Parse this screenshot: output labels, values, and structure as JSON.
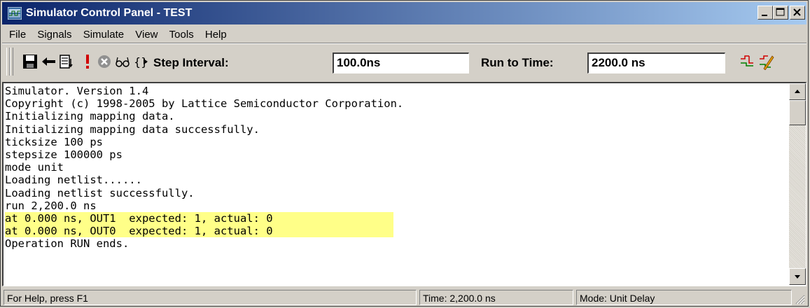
{
  "window": {
    "title": "Simulator Control Panel - TEST",
    "controls": [
      "minimize-icon",
      "maximize-icon",
      "close-icon"
    ]
  },
  "menu": [
    "File",
    "Signals",
    "Simulate",
    "View",
    "Tools",
    "Help"
  ],
  "toolbar": {
    "icons": [
      "save-icon",
      "back-arrow-icon",
      "list-step-icon",
      "run-exclamation-icon",
      "stop-icon",
      "glasses-icon",
      "step-into-icon"
    ],
    "step_interval_label": "Step Interval:",
    "step_interval_value": "100.0ns",
    "run_to_time_label": "Run to Time:",
    "run_to_time_value": "2200.0 ns",
    "right_icons": [
      "waveform-icon",
      "waveform-edit-icon"
    ]
  },
  "output": {
    "lines": [
      {
        "text": "Simulator. Version 1.4",
        "highlight": false
      },
      {
        "text": "Copyright (c) 1998-2005 by Lattice Semiconductor Corporation.",
        "highlight": false
      },
      {
        "text": "Initializing mapping data.",
        "highlight": false
      },
      {
        "text": "Initializing mapping data successfully.",
        "highlight": false
      },
      {
        "text": "ticksize 100 ps",
        "highlight": false
      },
      {
        "text": "stepsize 100000 ps",
        "highlight": false
      },
      {
        "text": "mode unit",
        "highlight": false
      },
      {
        "text": "Loading netlist......",
        "highlight": false
      },
      {
        "text": "Loading netlist successfully.",
        "highlight": false
      },
      {
        "text": "run 2,200.0 ns",
        "highlight": false
      },
      {
        "text": "at 0.000 ns, OUT1  expected: 1, actual: 0",
        "highlight": true
      },
      {
        "text": "at 0.000 ns, OUT0  expected: 1, actual: 0",
        "highlight": true
      },
      {
        "text": "Operation RUN ends.",
        "highlight": false
      }
    ],
    "highlight_color": "#ffff88"
  },
  "status": {
    "help": "For Help, press F1",
    "time": "Time: 2,200.0 ns",
    "mode": "Mode: Unit Delay"
  },
  "colors": {
    "titlebar_start": "#0a246a",
    "titlebar_end": "#a6caf0",
    "face": "#d4d0c8"
  }
}
